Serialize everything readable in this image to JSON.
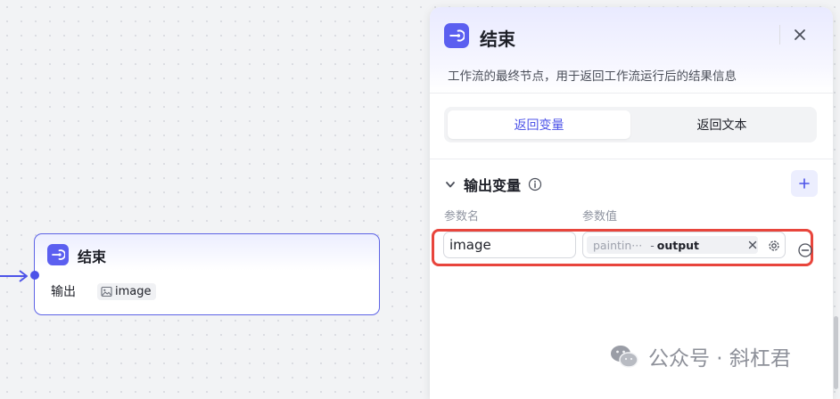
{
  "node": {
    "title": "结束",
    "output_label": "输出",
    "output_value": "image"
  },
  "panel": {
    "title": "结束",
    "description": "工作流的最终节点，用于返回工作流运行后的结果信息",
    "tabs": [
      {
        "label": "返回变量",
        "active": true
      },
      {
        "label": "返回文本",
        "active": false
      }
    ],
    "section_title": "输出变量",
    "columns": {
      "name": "参数名",
      "value": "参数值"
    },
    "param": {
      "name": "image",
      "source_node": "paintin···",
      "output_field": "output"
    }
  },
  "watermark": "公众号 · 斜杠君",
  "colors": {
    "accent": "#4d53e8",
    "node_icon": "#5b5ff0",
    "highlight": "#e8453c"
  },
  "icons": {
    "node_icon": "end-node-icon",
    "close": "close-icon",
    "collapse": "chevron-down-icon",
    "info": "info-icon",
    "add": "plus-icon",
    "clear": "clear-x-icon",
    "settings": "gear-icon",
    "remove": "minus-circle-icon",
    "image": "image-icon",
    "wechat": "wechat-icon"
  }
}
